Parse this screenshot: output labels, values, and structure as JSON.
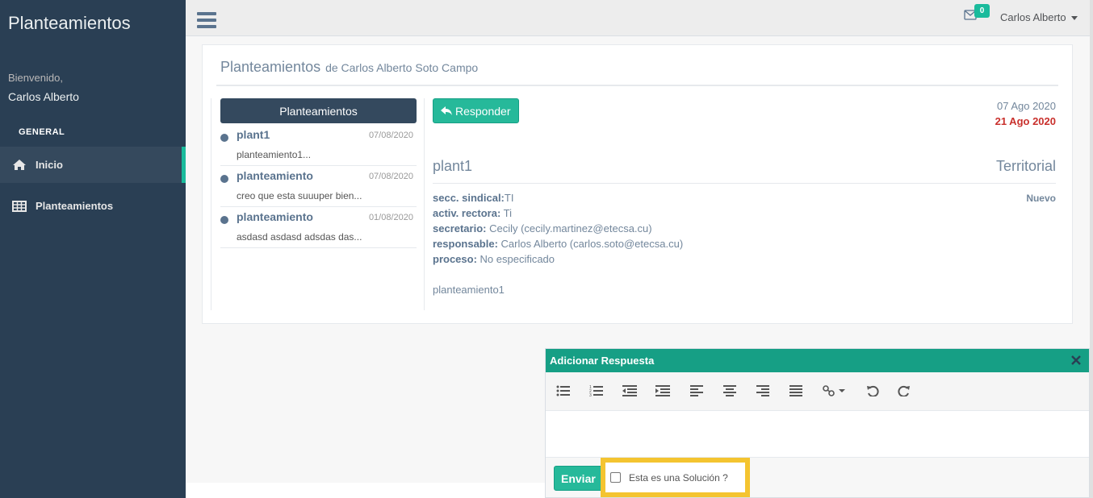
{
  "sidebar": {
    "brand": "Planteamientos",
    "welcome": "Bienvenido,",
    "username": "Carlos Alberto",
    "section_title": "GENERAL",
    "items": [
      {
        "label": "Inicio",
        "icon": "home-icon",
        "active": true
      },
      {
        "label": "Planteamientos",
        "icon": "table-icon",
        "active": false
      }
    ]
  },
  "topbar": {
    "mail_count": "0",
    "user_name": "Carlos Alberto"
  },
  "panel": {
    "title": "Planteamientos",
    "subtitle": "de Carlos Alberto Soto Campo",
    "list_header": "Planteamientos",
    "items": [
      {
        "title": "plant1",
        "date": "07/08/2020",
        "snippet": "planteamiento1..."
      },
      {
        "title": "planteamiento",
        "date": "07/08/2020",
        "snippet": "creo que esta suuuper bien..."
      },
      {
        "title": "planteamiento",
        "date": "01/08/2020",
        "snippet": "asdasd asdasd adsdas das..."
      }
    ]
  },
  "detail": {
    "reply_label": "Responder",
    "date_created": "07 Ago 2020",
    "date_due": "21 Ago 2020",
    "title": "plant1",
    "category": "Territorial",
    "status": "Nuevo",
    "fields": [
      {
        "label": "secc. sindical:",
        "value": "TI"
      },
      {
        "label": "activ. rectora:",
        "value": " Ti"
      },
      {
        "label": "secretario:",
        "value": " Cecily (cecily.martinez@etecsa.cu)"
      },
      {
        "label": "responsable:",
        "value": " Carlos Alberto (carlos.soto@etecsa.cu)"
      },
      {
        "label": "proceso:",
        "value": " No especificado"
      }
    ],
    "body": "planteamiento1"
  },
  "compose": {
    "title": "Adicionar Respuesta",
    "send_label": "Enviar",
    "solution_label": "Esta es una Solución ?",
    "toolbar_icons": [
      "bullet-list-icon",
      "numbered-list-icon",
      "outdent-icon",
      "indent-icon",
      "align-left-icon",
      "align-center-icon",
      "align-right-icon",
      "justify-icon",
      "link-icon",
      "undo-icon",
      "redo-icon"
    ]
  },
  "colors": {
    "sidebar_bg": "#2a3f54",
    "accent": "#1abb9c",
    "button": "#26b99a",
    "header_green": "#169f85",
    "due_date_red": "#c9302c",
    "highlight": "#f4c430"
  }
}
